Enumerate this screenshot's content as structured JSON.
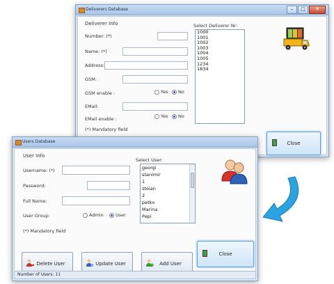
{
  "deliverer_window": {
    "title": "Deliverers Database",
    "section": "Deliverer Info",
    "fields": {
      "number_label": "Number: (*)",
      "name_label": "Name: (*)",
      "address_label": "Address:",
      "gsm_label": "GSM:",
      "gsm_enable_label": "GSM enable :",
      "email_label": "EMail:",
      "email_enable_label": "EMail enable :"
    },
    "radio_yes": "Yes",
    "radio_no": "No",
    "mandatory": "(*) Mandatory field",
    "select_label": "Select Deliverer Nr:",
    "deliverers": [
      "1000",
      "1001",
      "1002",
      "1003",
      "1004",
      "1005",
      "1234",
      "1834"
    ],
    "close_label": "Close",
    "window_buttons": {
      "minimize": "–",
      "maximize": "□",
      "close": "✕"
    }
  },
  "users_window": {
    "title": "Users Database",
    "section": "User Info",
    "username_label": "Username: (*)",
    "password_label": "Password:",
    "fullname_label": "Full Name:",
    "group_label": "User Group:",
    "admin_label": "Admin",
    "user_label": "User",
    "mandatory": "(*) Mandatory field",
    "select_label": "Select User:",
    "users": [
      "georgi",
      "stanimir",
      "1",
      "stoian",
      "2",
      "petko",
      "Marina",
      "Pepi"
    ],
    "buttons": {
      "delete": "Delete User",
      "update": "Update User",
      "add": "Add User",
      "close": "Close"
    },
    "status": "Number of Users: 11"
  },
  "colors": {
    "arrow": "#2aa3e0",
    "accent": "#2a5fbf"
  },
  "icons": [
    "truck-icon",
    "users-icon",
    "delete-user-icon",
    "update-user-icon",
    "add-user-icon",
    "close-door-icon"
  ]
}
